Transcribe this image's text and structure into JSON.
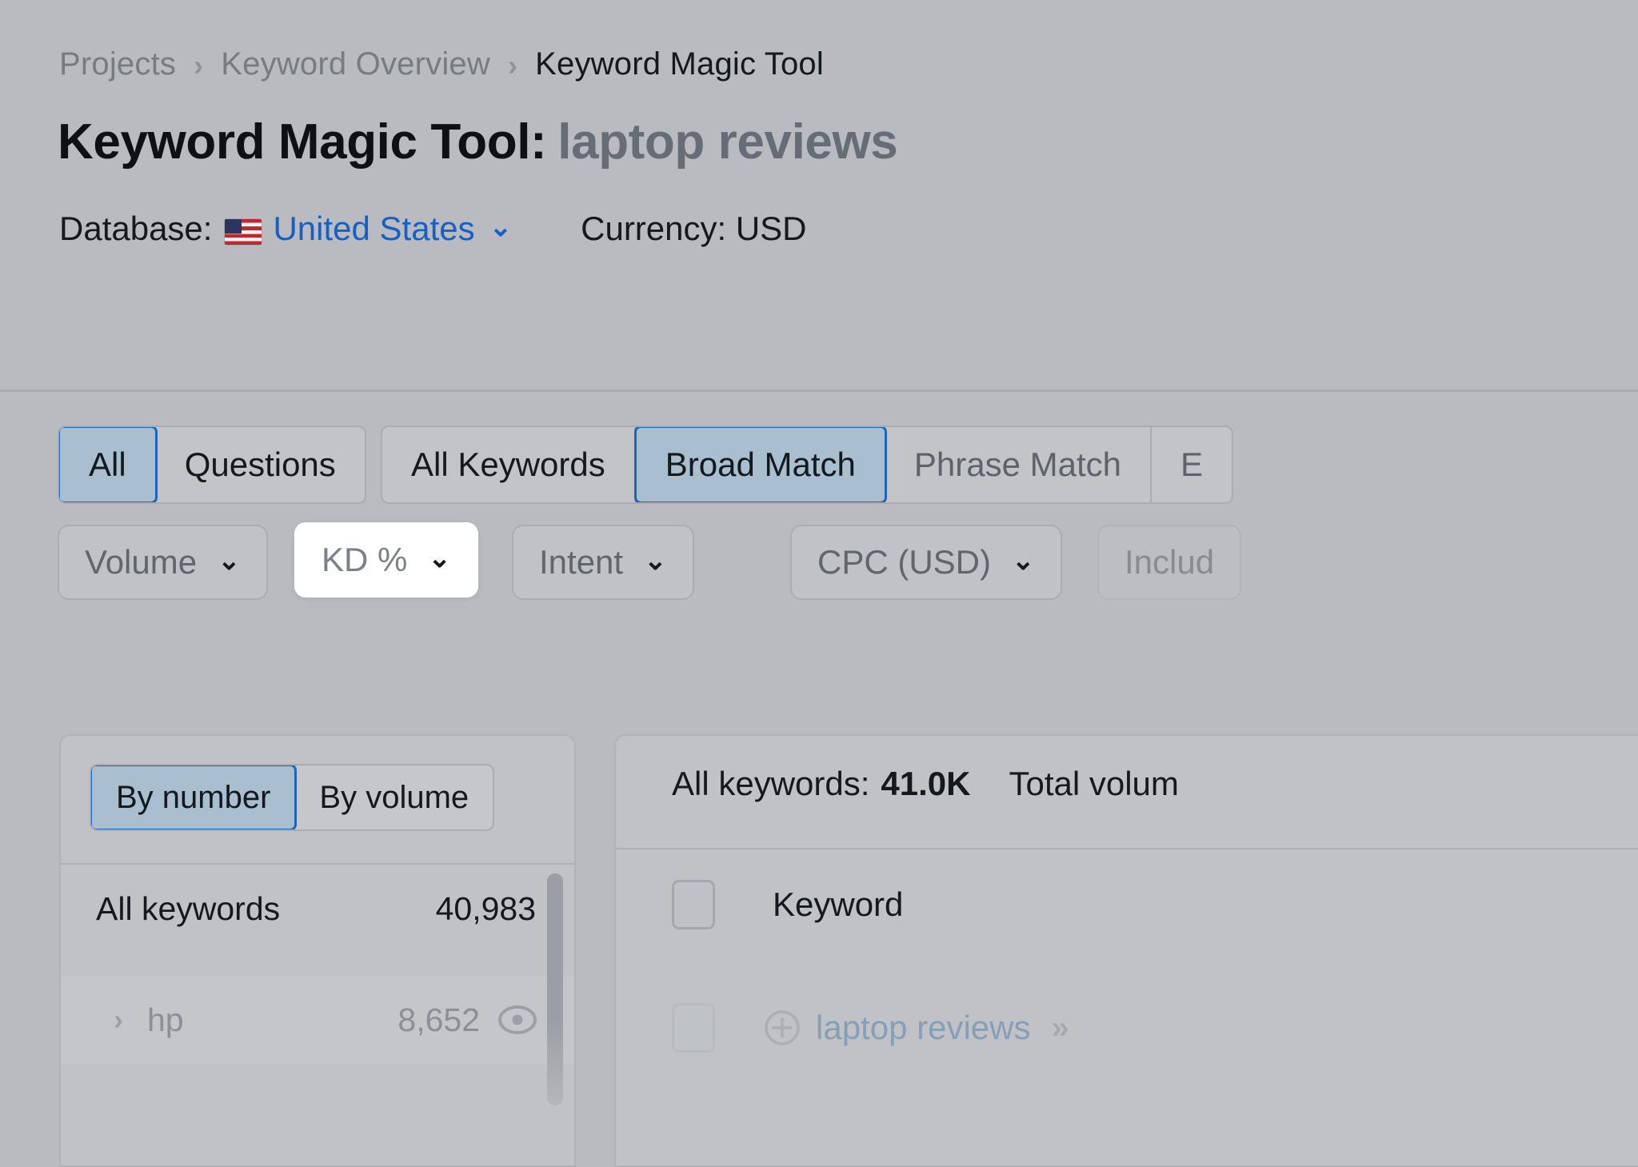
{
  "breadcrumb": {
    "items": [
      {
        "label": "Projects"
      },
      {
        "label": "Keyword Overview"
      },
      {
        "label": "Keyword Magic Tool"
      }
    ],
    "separator": "›"
  },
  "header": {
    "title": "Keyword Magic Tool:",
    "keyword": "laptop reviews",
    "database_label": "Database:",
    "database_value": "United States",
    "database_flag": "us-flag-icon",
    "database_caret": "⌄",
    "currency": "Currency: USD"
  },
  "filters": {
    "type_tabs": [
      {
        "label": "All",
        "active": true
      },
      {
        "label": "Questions",
        "active": false
      }
    ],
    "match_tabs": [
      {
        "label": "All Keywords",
        "active": false
      },
      {
        "label": "Broad Match",
        "active": true
      },
      {
        "label": "Phrase Match",
        "active": false
      },
      {
        "label": "E",
        "active": false
      }
    ],
    "chips": [
      {
        "label": "Volume",
        "caret": "⌄"
      },
      {
        "label": "KD %",
        "caret": "⌄"
      },
      {
        "label": "Intent",
        "caret": "⌄"
      },
      {
        "label": "CPC (USD)",
        "caret": "⌄"
      },
      {
        "label": "Includ",
        "caret": ""
      }
    ]
  },
  "left_panel": {
    "groupby": [
      {
        "label": "By number",
        "active": true
      },
      {
        "label": "By volume",
        "active": false
      }
    ],
    "rows": [
      {
        "name": "All keywords",
        "count": "40,983",
        "chevron": "",
        "eye": false
      },
      {
        "name": "hp",
        "count": "8,652",
        "chevron": "›",
        "eye": true
      }
    ]
  },
  "right_panel": {
    "summary_label": "All keywords:",
    "summary_value": "41.0K",
    "summary_second": "Total volum",
    "column_header": "Keyword",
    "rows": [
      {
        "keyword": "laptop reviews",
        "expand": "»"
      }
    ]
  },
  "colors": {
    "background": "#b9bbc0",
    "accent_blue": "#1560c4",
    "active_tab_bg": "#a9bece",
    "active_tab_border": "#1c65b8",
    "link_blue": "#7d9ab5"
  }
}
